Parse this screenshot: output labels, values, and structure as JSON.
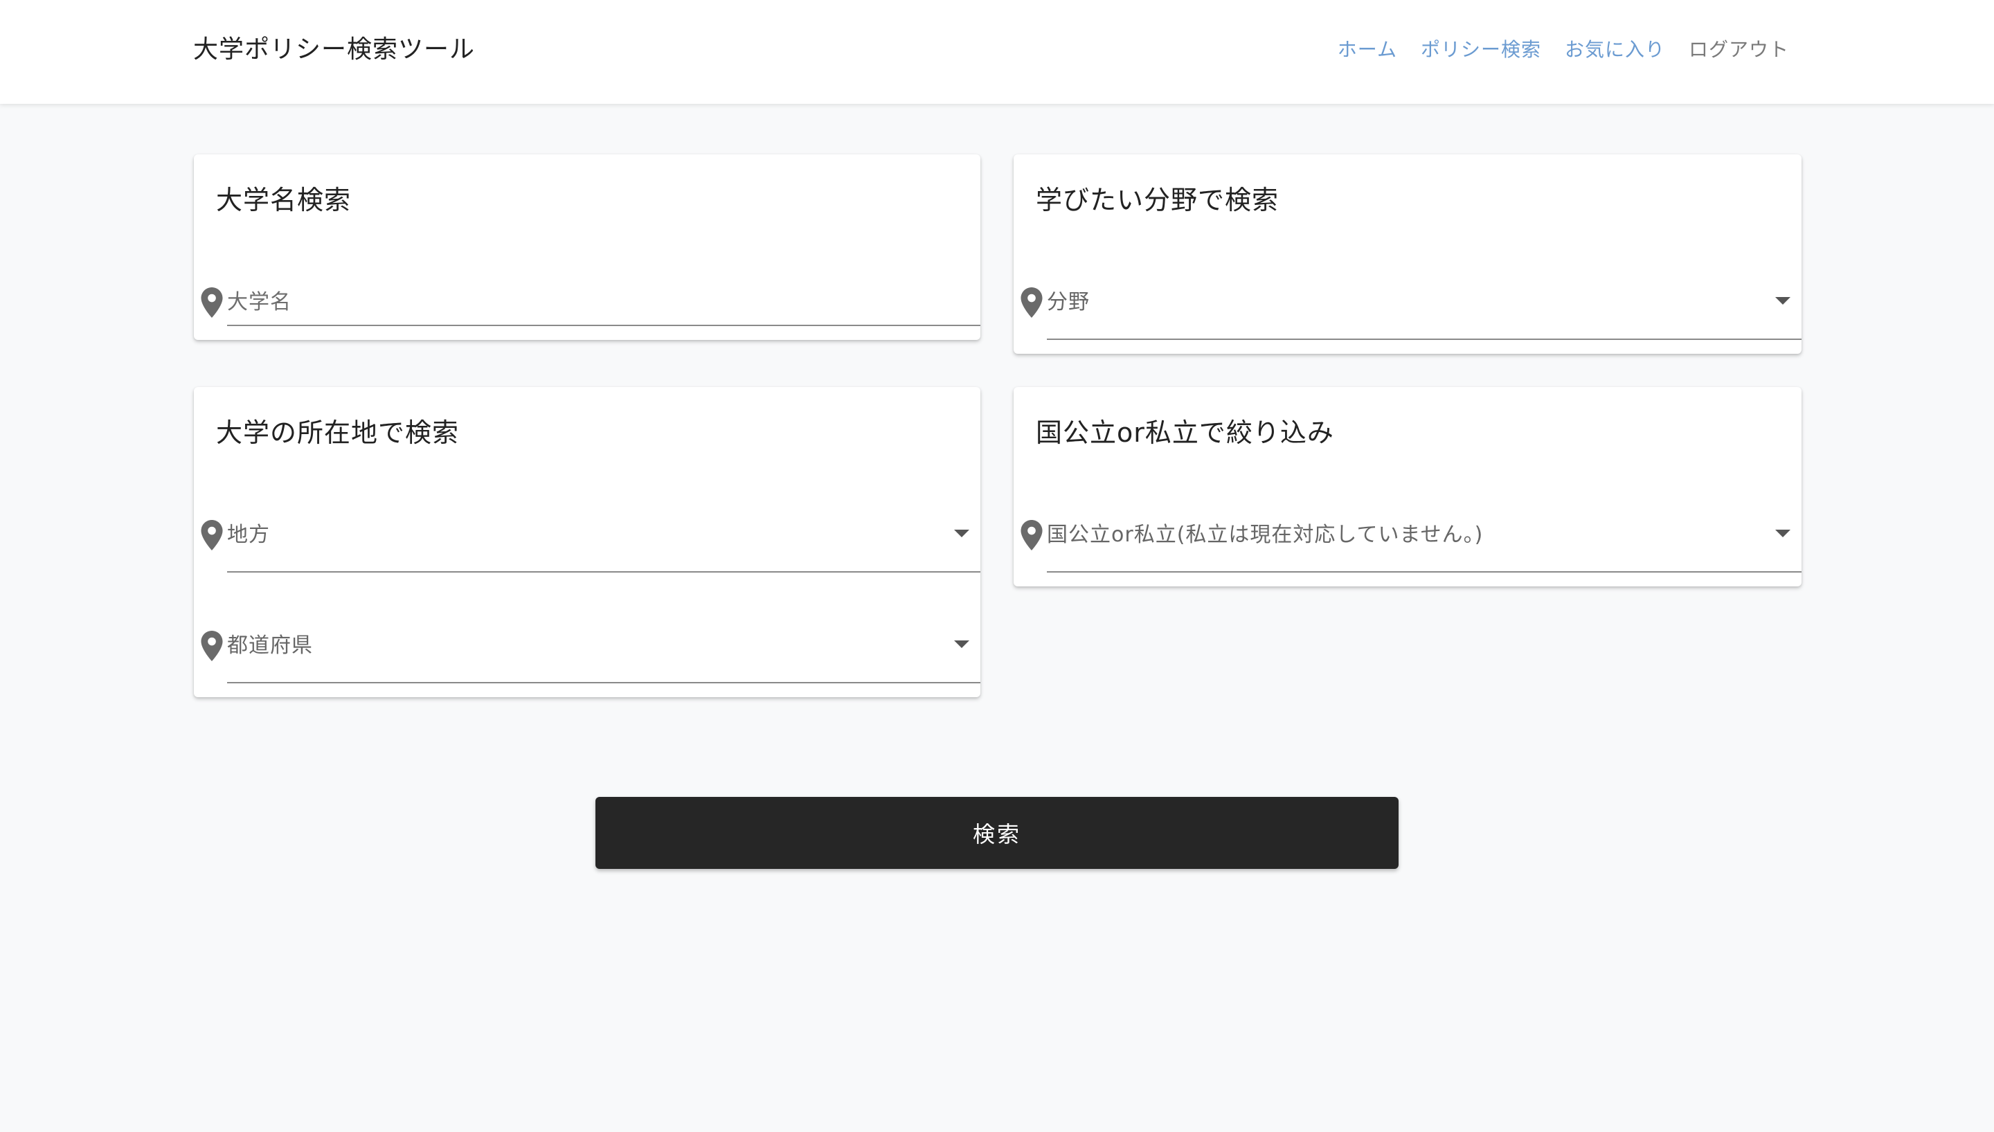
{
  "header": {
    "title": "大学ポリシー検索ツール",
    "nav": [
      {
        "label": "ホーム"
      },
      {
        "label": "ポリシー検索"
      },
      {
        "label": "お気に入り"
      },
      {
        "label": "ログアウト"
      }
    ]
  },
  "cards": {
    "university_name": {
      "title": "大学名検索",
      "field": {
        "placeholder": "大学名",
        "icon": "map-marker-icon"
      }
    },
    "field_of_study": {
      "title": "学びたい分野で検索",
      "field": {
        "label": "分野",
        "icon": "map-marker-icon"
      }
    },
    "location": {
      "title": "大学の所在地で検索",
      "region": {
        "label": "地方",
        "icon": "map-marker-icon"
      },
      "prefecture": {
        "label": "都道府県",
        "icon": "map-marker-icon"
      }
    },
    "type": {
      "title": "国公立or私立で絞り込み",
      "field": {
        "label": "国公立or私立(私立は現在対応していません。)",
        "icon": "map-marker-icon"
      }
    }
  },
  "search_button": {
    "label": "検索"
  },
  "colors": {
    "nav_link": "#6b9bd1",
    "nav_logout": "#7a7a7a",
    "button_bg": "#262626",
    "page_bg": "#f8f9fa"
  }
}
